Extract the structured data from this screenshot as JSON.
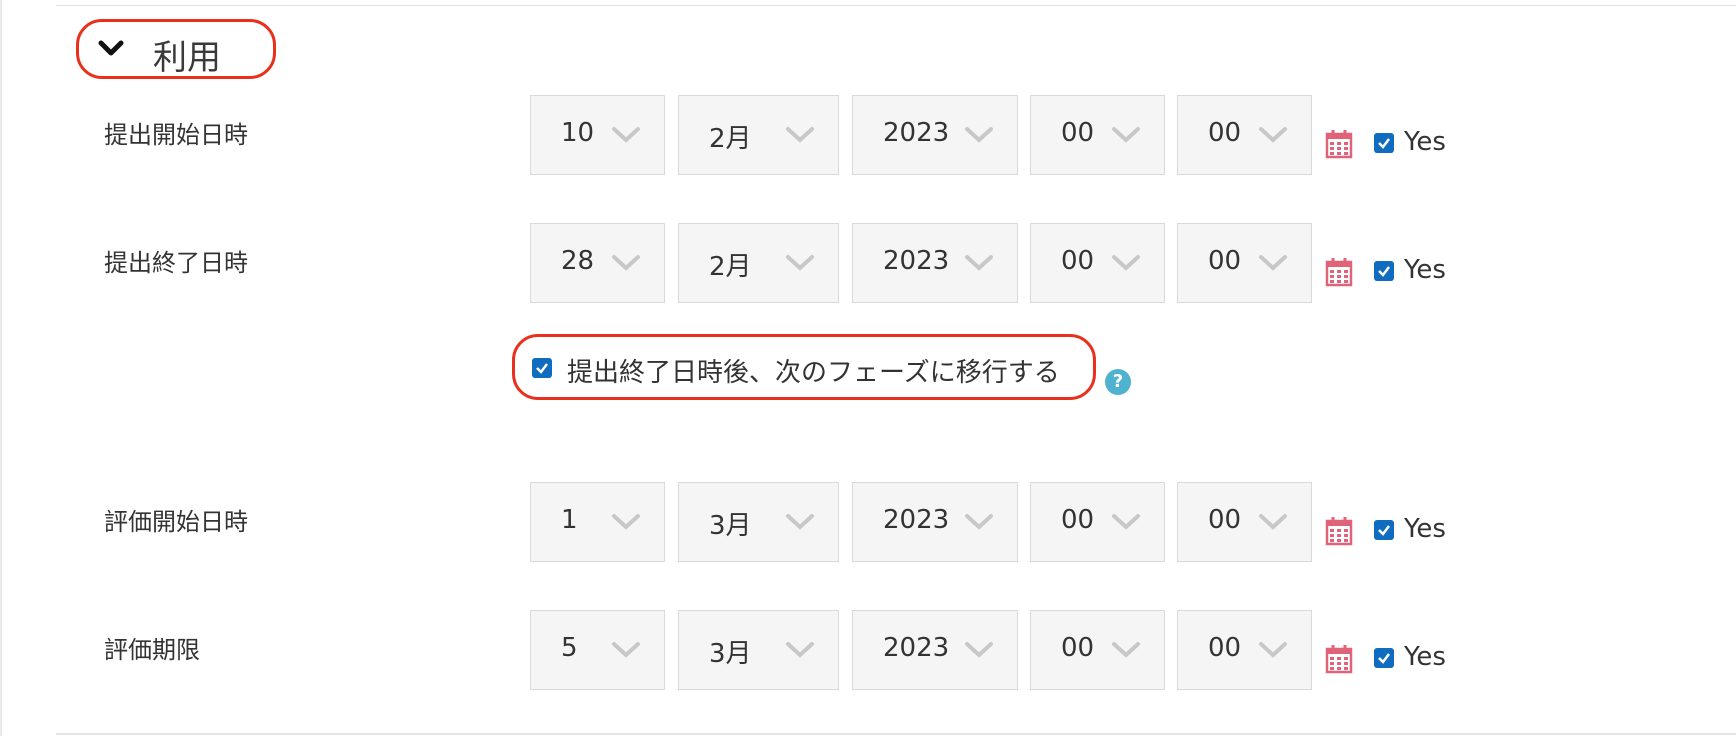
{
  "section": {
    "title": "利用"
  },
  "rows": [
    {
      "label": "提出開始日時",
      "day": "10",
      "month": "2月",
      "year": "2023",
      "hour": "00",
      "minute": "00",
      "enabled_label": "Yes"
    },
    {
      "label": "提出終了日時",
      "day": "28",
      "month": "2月",
      "year": "2023",
      "hour": "00",
      "minute": "00",
      "enabled_label": "Yes"
    },
    {
      "label": "評価開始日時",
      "day": "1",
      "month": "3月",
      "year": "2023",
      "hour": "00",
      "minute": "00",
      "enabled_label": "Yes"
    },
    {
      "label": "評価期限",
      "day": "5",
      "month": "3月",
      "year": "2023",
      "hour": "00",
      "minute": "00",
      "enabled_label": "Yes"
    }
  ],
  "auto_switch": {
    "label": "提出終了日時後、次のフェーズに移行する",
    "checked": true,
    "help_icon": "question-circle-icon"
  },
  "icons": {
    "calendar": "calendar-icon",
    "chevron": "chevron-down-icon"
  },
  "colors": {
    "highlight": "#e8301c",
    "checkbox": "#0f6cbf",
    "select_bg": "#f5f5f5",
    "calendar": "#e06379",
    "help": "#4fb3cf"
  }
}
